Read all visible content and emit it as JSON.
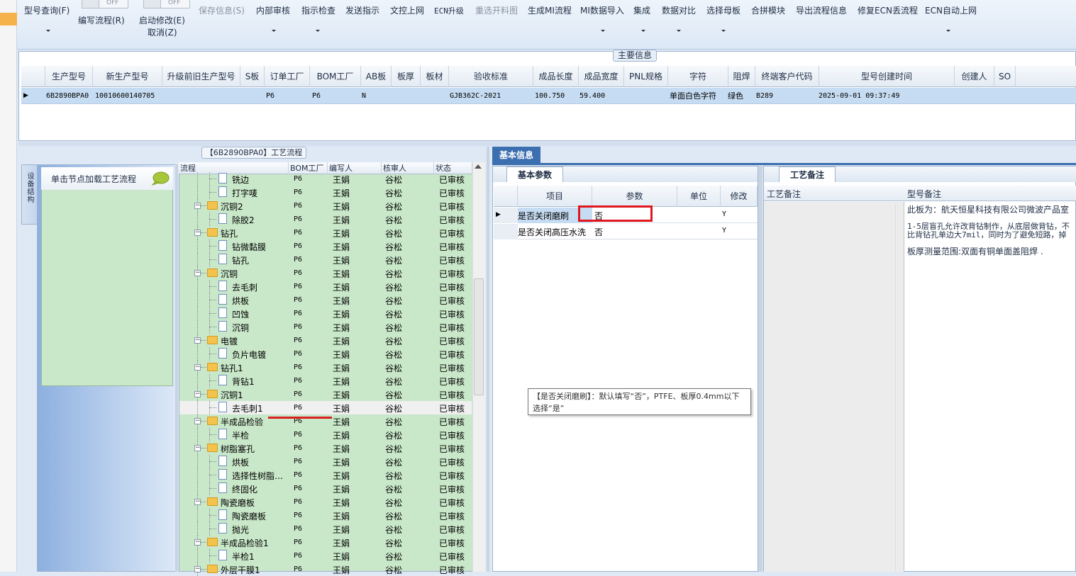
{
  "toolbar": {
    "items": [
      {
        "label": "型号查询(F)"
      },
      {
        "label": "编写流程(R)"
      },
      {
        "label": "启动修改(E)"
      },
      {
        "label": "取消(Z)"
      },
      {
        "label": "保存信息(S)"
      },
      {
        "label": "内部审核"
      },
      {
        "label": "指示检查"
      },
      {
        "label": "发送指示"
      },
      {
        "label": "文控上网"
      },
      {
        "label": "ECN升级"
      },
      {
        "label": "重选开料图"
      },
      {
        "label": "生成MI流程"
      },
      {
        "label": "MI数据导入"
      },
      {
        "label": "集成"
      },
      {
        "label": "数据对比"
      },
      {
        "label": "选择母板"
      },
      {
        "label": "合拼模块"
      },
      {
        "label": "导出流程信息"
      },
      {
        "label": "修复ECN丢流程"
      },
      {
        "label": "ECN自动上网"
      }
    ],
    "toggle_off": "OFF"
  },
  "main_info": {
    "title": "主要信息",
    "columns": [
      "生产型号",
      "新生产型号",
      "升级前旧生产型号",
      "S板",
      "订单工厂",
      "BOM工厂",
      "AB板",
      "板厚",
      "板材",
      "验收标准",
      "成品长度",
      "成品宽度",
      "PNL规格",
      "字符",
      "阻焊",
      "终端客户代码",
      "型号创建时间",
      "创建人",
      "SO"
    ],
    "row": {
      "model": "6B2890BPA0",
      "new_model": "10010600140705",
      "order_factory": "P6",
      "bom_factory": "P6",
      "ab": "N",
      "standard": "GJB362C-2021",
      "length": "100.750",
      "width": "59.400",
      "char": "单面白色字符",
      "mask": "绿色",
      "customer_code": "B289",
      "created": "2025-09-01 09:37:49"
    }
  },
  "nav": {
    "tab_label": "设备结构",
    "load_label": "单击节点加载工艺流程"
  },
  "flow": {
    "title": "【6B2890BPA0】工艺流程",
    "columns": [
      "流程",
      "BOM工厂",
      "编写人",
      "核审人",
      "状态"
    ],
    "rows": [
      {
        "name": "铣边",
        "level": 2,
        "factory": "P6",
        "writer": "王娟",
        "reviewer": "谷松",
        "status": "已审核"
      },
      {
        "name": "打字唛",
        "level": 2,
        "factory": "P6",
        "writer": "王娟",
        "reviewer": "谷松",
        "status": "已审核"
      },
      {
        "name": "沉铜2",
        "level": 1,
        "factory": "P6",
        "writer": "王娟",
        "reviewer": "谷松",
        "status": "已审核"
      },
      {
        "name": "除胶2",
        "level": 2,
        "factory": "P6",
        "writer": "王娟",
        "reviewer": "谷松",
        "status": "已审核"
      },
      {
        "name": "钻孔",
        "level": 1,
        "factory": "P6",
        "writer": "王娟",
        "reviewer": "谷松",
        "status": "已审核"
      },
      {
        "name": "钻微黏膜",
        "level": 2,
        "factory": "P6",
        "writer": "王娟",
        "reviewer": "谷松",
        "status": "已审核"
      },
      {
        "name": "钻孔",
        "level": 2,
        "factory": "P6",
        "writer": "王娟",
        "reviewer": "谷松",
        "status": "已审核"
      },
      {
        "name": "沉铜",
        "level": 1,
        "factory": "P6",
        "writer": "王娟",
        "reviewer": "谷松",
        "status": "已审核"
      },
      {
        "name": "去毛刺",
        "level": 2,
        "factory": "P6",
        "writer": "王娟",
        "reviewer": "谷松",
        "status": "已审核"
      },
      {
        "name": "烘板",
        "level": 2,
        "factory": "P6",
        "writer": "王娟",
        "reviewer": "谷松",
        "status": "已审核"
      },
      {
        "name": "凹蚀",
        "level": 2,
        "factory": "P6",
        "writer": "王娟",
        "reviewer": "谷松",
        "status": "已审核"
      },
      {
        "name": "沉铜",
        "level": 2,
        "factory": "P6",
        "writer": "王娟",
        "reviewer": "谷松",
        "status": "已审核"
      },
      {
        "name": "电镀",
        "level": 1,
        "factory": "P6",
        "writer": "王娟",
        "reviewer": "谷松",
        "status": "已审核"
      },
      {
        "name": "负片电镀",
        "level": 2,
        "factory": "P6",
        "writer": "王娟",
        "reviewer": "谷松",
        "status": "已审核"
      },
      {
        "name": "钻孔1",
        "level": 1,
        "factory": "P6",
        "writer": "王娟",
        "reviewer": "谷松",
        "status": "已审核"
      },
      {
        "name": "背钻1",
        "level": 2,
        "factory": "P6",
        "writer": "王娟",
        "reviewer": "谷松",
        "status": "已审核"
      },
      {
        "name": "沉铜1",
        "level": 1,
        "factory": "P6",
        "writer": "王娟",
        "reviewer": "谷松",
        "status": "已审核"
      },
      {
        "name": "去毛刺1",
        "level": 2,
        "factory": "P6",
        "writer": "王娟",
        "reviewer": "谷松",
        "status": "已审核",
        "selected": true
      },
      {
        "name": "半成品检验",
        "level": 1,
        "factory": "P6",
        "writer": "王娟",
        "reviewer": "谷松",
        "status": "已审核"
      },
      {
        "name": "半检",
        "level": 2,
        "factory": "P6",
        "writer": "王娟",
        "reviewer": "谷松",
        "status": "已审核"
      },
      {
        "name": "树脂塞孔",
        "level": 1,
        "factory": "P6",
        "writer": "王娟",
        "reviewer": "谷松",
        "status": "已审核"
      },
      {
        "name": "烘板",
        "level": 2,
        "factory": "P6",
        "writer": "王娟",
        "reviewer": "谷松",
        "status": "已审核"
      },
      {
        "name": "选择性树脂…",
        "level": 2,
        "factory": "P6",
        "writer": "王娟",
        "reviewer": "谷松",
        "status": "已审核"
      },
      {
        "name": "终固化",
        "level": 2,
        "factory": "P6",
        "writer": "王娟",
        "reviewer": "谷松",
        "status": "已审核"
      },
      {
        "name": "陶瓷磨板",
        "level": 1,
        "factory": "P6",
        "writer": "王娟",
        "reviewer": "谷松",
        "status": "已审核"
      },
      {
        "name": "陶瓷磨板",
        "level": 2,
        "factory": "P6",
        "writer": "王娟",
        "reviewer": "谷松",
        "status": "已审核"
      },
      {
        "name": "抛光",
        "level": 2,
        "factory": "P6",
        "writer": "王娟",
        "reviewer": "谷松",
        "status": "已审核"
      },
      {
        "name": "半成品检验1",
        "level": 1,
        "factory": "P6",
        "writer": "王娟",
        "reviewer": "谷松",
        "status": "已审核"
      },
      {
        "name": "半检1",
        "level": 2,
        "factory": "P6",
        "writer": "王娟",
        "reviewer": "谷松",
        "status": "已审核"
      },
      {
        "name": "外层干膜1",
        "level": 1,
        "factory": "P6",
        "writer": "王娟",
        "reviewer": "谷松",
        "status": "已审核"
      }
    ]
  },
  "basic": {
    "tab": "基本信息",
    "params_tab": "基本参数",
    "columns": [
      "项目",
      "参数",
      "单位",
      "修改"
    ],
    "rows": [
      {
        "item": "是否关闭磨刷",
        "value": "否",
        "unit": "",
        "modify": "Y"
      },
      {
        "item": "是否关闭高压水洗",
        "value": "否",
        "unit": "",
        "modify": "Y"
      }
    ],
    "tooltip": "【是否关闭磨刷】：默认填写“否”，PTFE、板厚0.4mm以下选择“是”"
  },
  "remark": {
    "tab": "工艺备注",
    "col1": "工艺备注",
    "col2": "型号备注",
    "lines": [
      "此板为：航天恒星科技有限公司微波产品室",
      "1-5层盲孔允许改背钻制作，从底层做背钻，不",
      "比背钻孔单边大7mil，同时为了避免短路，掉",
      "板厚测量范围:双面有铜单面盖阻焊 ."
    ]
  },
  "colors": {
    "accent": "#3c6fb0",
    "tree_bg": "#c9e7c9",
    "selected_row": "#c6dcf2",
    "highlight_red": "#e0161f"
  }
}
